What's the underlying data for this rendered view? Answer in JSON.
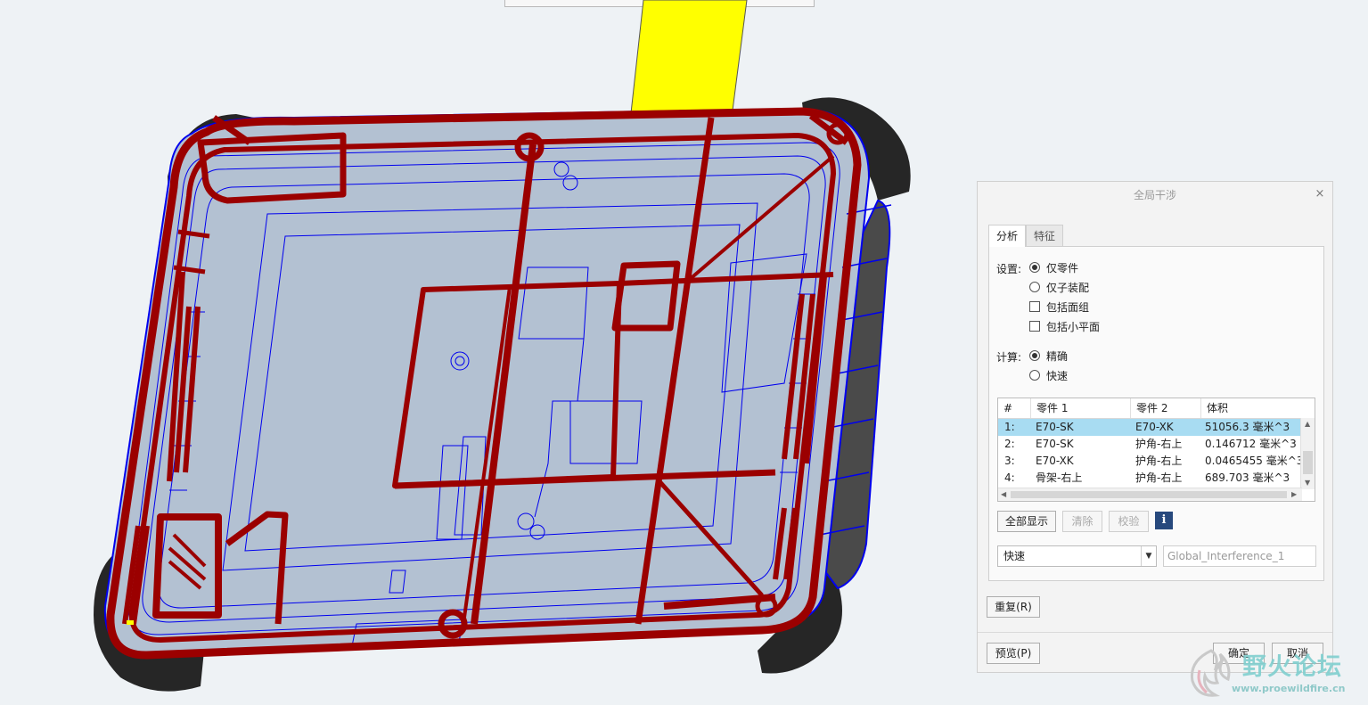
{
  "dialog": {
    "title": "全局干涉",
    "close_glyph": "×",
    "tabs": [
      {
        "label": "分析",
        "active": true
      },
      {
        "label": "特征",
        "active": false
      }
    ],
    "settings_label": "设置:",
    "settings_options": {
      "part_only": {
        "label": "仅零件",
        "selected": true
      },
      "subassembly_only": {
        "label": "仅子装配",
        "selected": false
      }
    },
    "checkboxes": {
      "include_quilts": {
        "label": "包括面组",
        "checked": false
      },
      "include_facets": {
        "label": "包括小平面",
        "checked": false
      }
    },
    "compute_label": "计算:",
    "compute_options": {
      "exact": {
        "label": "精确",
        "selected": true
      },
      "quick": {
        "label": "快速",
        "selected": false
      }
    },
    "table": {
      "headers": [
        "#",
        "零件 1",
        "零件 2",
        "体积"
      ],
      "rows": [
        {
          "num": "1:",
          "part1": "E70-SK",
          "part2": "E70-XK",
          "volume": "51056.3 毫米^3",
          "selected": true
        },
        {
          "num": "2:",
          "part1": "E70-SK",
          "part2": "护角-右上",
          "volume": "0.146712 毫米^3",
          "selected": false
        },
        {
          "num": "3:",
          "part1": "E70-XK",
          "part2": "护角-右上",
          "volume": "0.0465455 毫米^3",
          "selected": false
        },
        {
          "num": "4:",
          "part1": "骨架-右上",
          "part2": "护角-右上",
          "volume": "689.703 毫米^3",
          "selected": false
        }
      ]
    },
    "buttons": {
      "show_all": "全部显示",
      "clear": "清除",
      "verify": "校验",
      "info": "i",
      "repeat": "重复(R)",
      "preview": "预览(P)",
      "ok": "确定",
      "cancel": "取消"
    },
    "method_select": "快速",
    "name_field": "Global_Interference_1"
  },
  "watermark": {
    "text": "野火论坛",
    "url": "www.proewildfire.cn"
  },
  "colors": {
    "background": "#eef2f5",
    "interference_red": "#9b0000",
    "wireframe_blue": "#0000ee",
    "shell_fill": "#b3c1d2",
    "bumper_dark": "#262626",
    "datum_yellow": "#ffff00",
    "selection_blue": "#a8dcf2",
    "info_icon": "#27497d"
  }
}
